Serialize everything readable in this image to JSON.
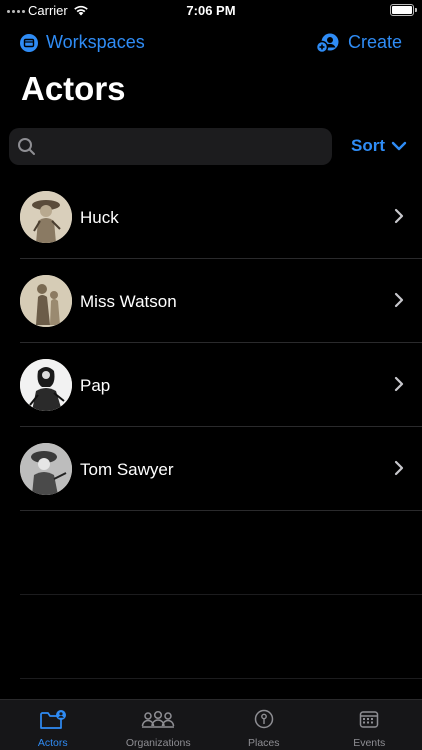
{
  "status_bar": {
    "carrier": "Carrier",
    "time": "7:06 PM"
  },
  "nav": {
    "back_label": "Workspaces",
    "create_label": "Create"
  },
  "page_title": "Actors",
  "search": {
    "placeholder": "",
    "value": ""
  },
  "sort_label": "Sort",
  "actors": [
    {
      "name": "Huck"
    },
    {
      "name": "Miss Watson"
    },
    {
      "name": "Pap"
    },
    {
      "name": "Tom Sawyer"
    }
  ],
  "tabs": [
    {
      "label": "Actors",
      "icon": "actors-folder-icon",
      "active": true
    },
    {
      "label": "Organizations",
      "icon": "organizations-people-icon",
      "active": false
    },
    {
      "label": "Places",
      "icon": "places-pin-icon",
      "active": false
    },
    {
      "label": "Events",
      "icon": "events-calendar-icon",
      "active": false
    }
  ],
  "colors": {
    "accent": "#2f8cf5",
    "background": "#000000",
    "search_bg": "#1c1c1e"
  }
}
